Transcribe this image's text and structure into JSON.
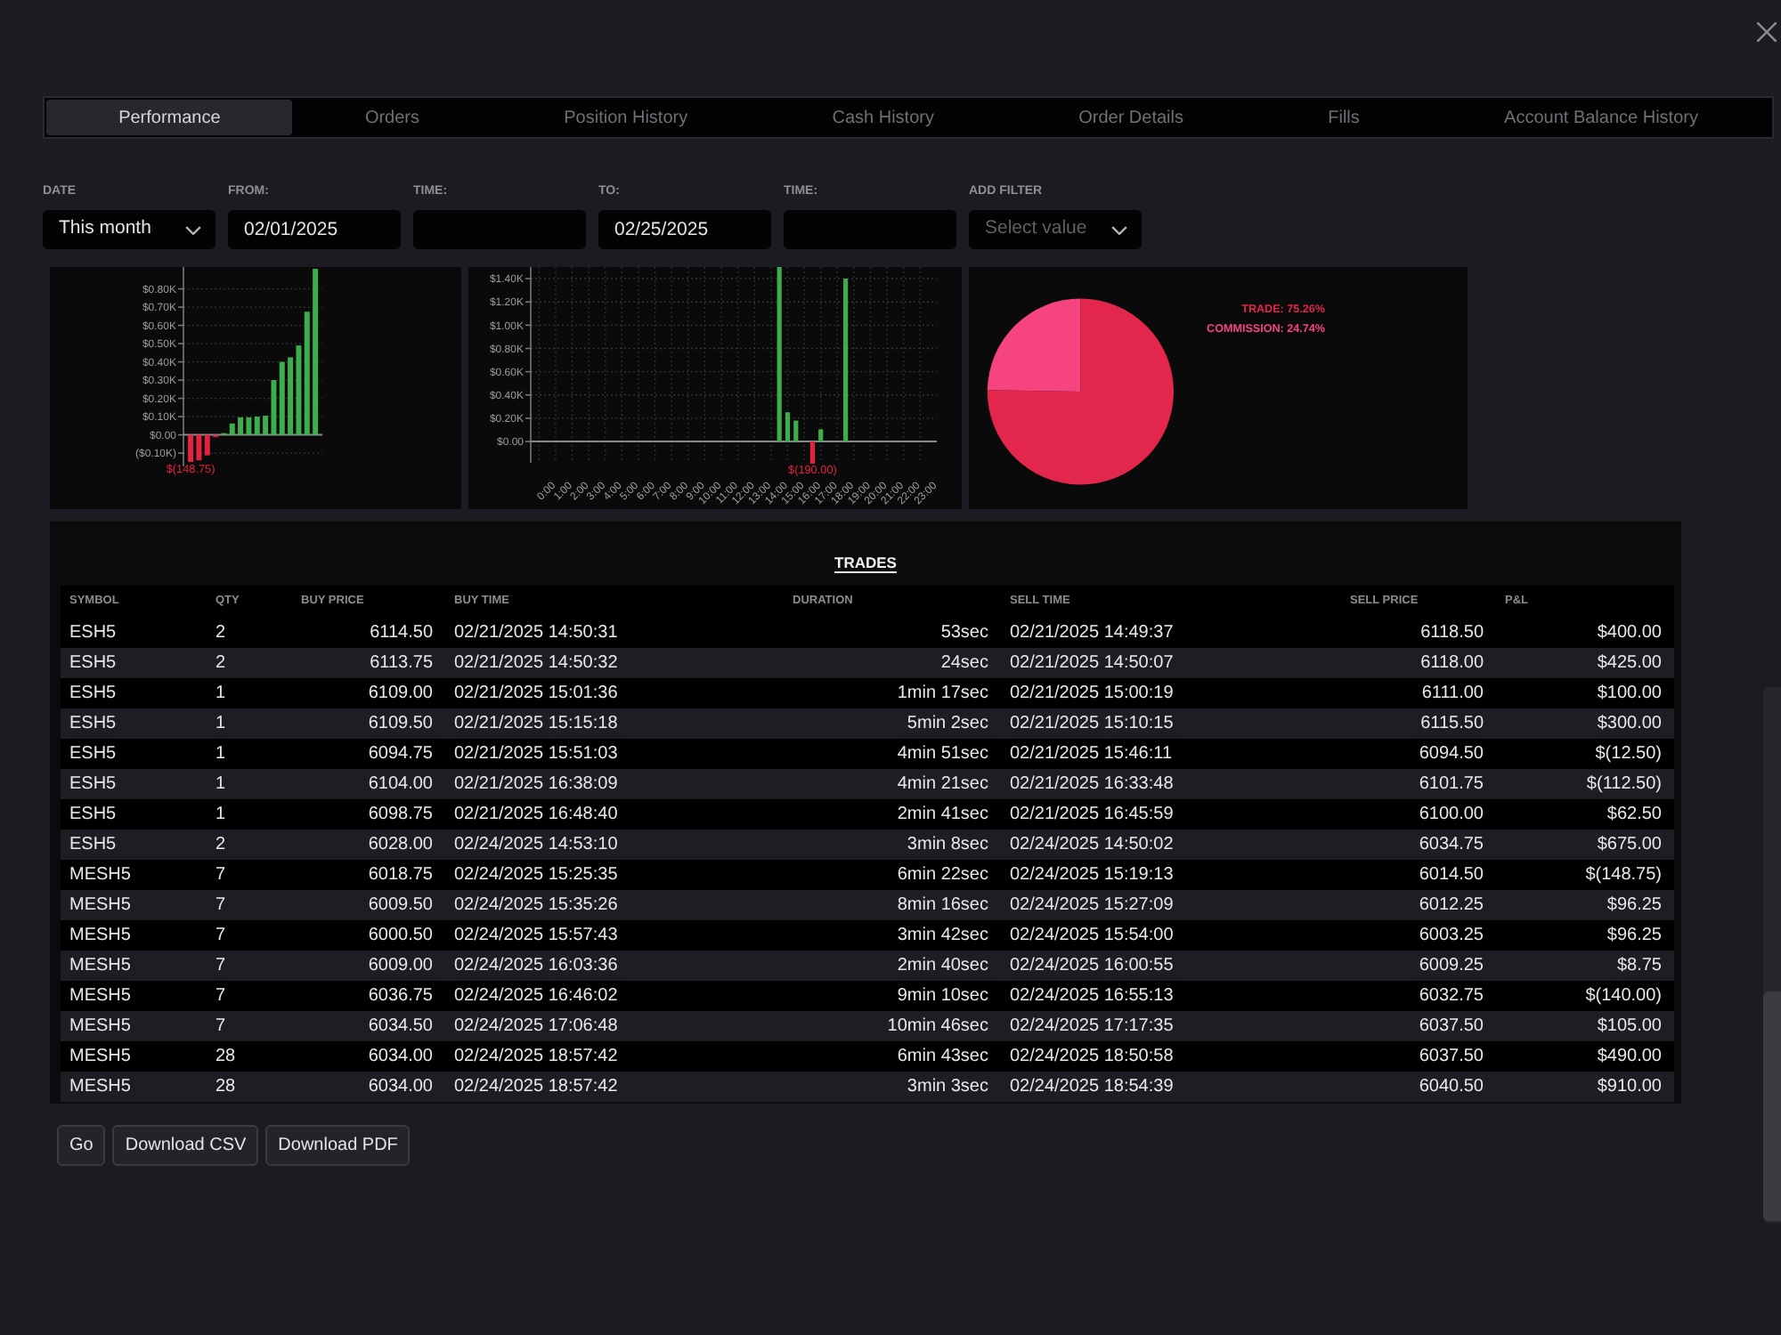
{
  "tabs": [
    {
      "label": "Performance",
      "selected": true
    },
    {
      "label": "Orders",
      "selected": false
    },
    {
      "label": "Position History",
      "selected": false
    },
    {
      "label": "Cash History",
      "selected": false
    },
    {
      "label": "Order Details",
      "selected": false
    },
    {
      "label": "Fills",
      "selected": false
    },
    {
      "label": "Account Balance History",
      "selected": false
    }
  ],
  "filters": [
    {
      "label": "DATE",
      "kind": "select",
      "value": "This month"
    },
    {
      "label": "FROM:",
      "kind": "input",
      "value": "02/01/2025"
    },
    {
      "label": "TIME:",
      "kind": "input"
    },
    {
      "label": "TO:",
      "kind": "input",
      "value": "02/25/2025"
    },
    {
      "label": "TIME:",
      "kind": "input"
    },
    {
      "label": "ADD FILTER",
      "kind": "select",
      "placeholder": "Select value"
    }
  ],
  "charts": [
    {
      "chart_data": {
        "type": "bar",
        "values": [
          -148.75,
          -140,
          -112.5,
          -12.5,
          8.75,
          62.5,
          96.25,
          96.25,
          100,
          105,
          300,
          400,
          425,
          490,
          675,
          910
        ],
        "ylim": [
          -160,
          920
        ],
        "yticks": [
          {
            "value": -100,
            "label": "($0.10K)"
          },
          {
            "value": 0,
            "label": "$0.00"
          },
          {
            "value": 100,
            "label": "$0.10K"
          },
          {
            "value": 200,
            "label": "$0.20K"
          },
          {
            "value": 300,
            "label": "$0.30K"
          },
          {
            "value": 400,
            "label": "$0.40K"
          },
          {
            "value": 500,
            "label": "$0.50K"
          },
          {
            "value": 600,
            "label": "$0.60K"
          },
          {
            "value": 700,
            "label": "$0.70K"
          },
          {
            "value": 800,
            "label": "$0.80K"
          }
        ],
        "grid": true,
        "annotations": [
          "$(148.75)"
        ]
      }
    },
    {
      "chart_data": {
        "type": "bar",
        "x": [
          14.5,
          15,
          15.5,
          16.5,
          17,
          18.5
        ],
        "values": [
          1500,
          251.25,
          180,
          -190,
          105,
          1400
        ],
        "xlim": [
          -0.5,
          24
        ],
        "ylim": [
          -200,
          1500
        ],
        "xticks": [
          {
            "value": 0,
            "label": "0:00"
          },
          {
            "value": 1,
            "label": "1:00"
          },
          {
            "value": 2,
            "label": "2:00"
          },
          {
            "value": 3,
            "label": "3:00"
          },
          {
            "value": 4,
            "label": "4:00"
          },
          {
            "value": 5,
            "label": "5:00"
          },
          {
            "value": 6,
            "label": "6:00"
          },
          {
            "value": 7,
            "label": "7:00"
          },
          {
            "value": 8,
            "label": "8:00"
          },
          {
            "value": 9,
            "label": "9:00"
          },
          {
            "value": 10,
            "label": "10:00"
          },
          {
            "value": 11,
            "label": "11:00"
          },
          {
            "value": 12,
            "label": "12:00"
          },
          {
            "value": 13,
            "label": "13:00"
          },
          {
            "value": 14,
            "label": "14:00"
          },
          {
            "value": 15,
            "label": "15:00"
          },
          {
            "value": 16,
            "label": "16:00"
          },
          {
            "value": 17,
            "label": "17:00"
          },
          {
            "value": 18,
            "label": "18:00"
          },
          {
            "value": 19,
            "label": "19:00"
          },
          {
            "value": 20,
            "label": "20:00"
          },
          {
            "value": 21,
            "label": "21:00"
          },
          {
            "value": 22,
            "label": "22:00"
          },
          {
            "value": 23,
            "label": "23:00"
          }
        ],
        "yticks": [
          {
            "value": 0,
            "label": "$0.00"
          },
          {
            "value": 200,
            "label": "$0.20K"
          },
          {
            "value": 400,
            "label": "$0.40K"
          },
          {
            "value": 600,
            "label": "$0.60K"
          },
          {
            "value": 800,
            "label": "$0.80K"
          },
          {
            "value": 1000,
            "label": "$1.00K"
          },
          {
            "value": 1200,
            "label": "$1.20K"
          },
          {
            "value": 1400,
            "label": "$1.40K"
          }
        ],
        "grid": true,
        "annotations": [
          "$(190.00)"
        ]
      }
    },
    {
      "legend": [
        "TRADE: 75.26%",
        "COMMISSION: 24.74%"
      ],
      "chart_data": {
        "type": "pie",
        "values": [
          75.26,
          24.74
        ]
      }
    }
  ],
  "trades": {
    "title": "TRADES",
    "columns": [
      "SYMBOL",
      "QTY",
      "BUY PRICE",
      "BUY TIME",
      "DURATION",
      "SELL TIME",
      "SELL PRICE",
      "P&L"
    ],
    "rows": [
      [
        "ESH5",
        "2",
        "6114.50",
        "02/21/2025 14:50:31",
        "53sec",
        "02/21/2025 14:49:37",
        "6118.50",
        "$400.00"
      ],
      [
        "ESH5",
        "2",
        "6113.75",
        "02/21/2025 14:50:32",
        "24sec",
        "02/21/2025 14:50:07",
        "6118.00",
        "$425.00"
      ],
      [
        "ESH5",
        "1",
        "6109.00",
        "02/21/2025 15:01:36",
        "1min 17sec",
        "02/21/2025 15:00:19",
        "6111.00",
        "$100.00"
      ],
      [
        "ESH5",
        "1",
        "6109.50",
        "02/21/2025 15:15:18",
        "5min 2sec",
        "02/21/2025 15:10:15",
        "6115.50",
        "$300.00"
      ],
      [
        "ESH5",
        "1",
        "6094.75",
        "02/21/2025 15:51:03",
        "4min 51sec",
        "02/21/2025 15:46:11",
        "6094.50",
        "$(12.50)"
      ],
      [
        "ESH5",
        "1",
        "6104.00",
        "02/21/2025 16:38:09",
        "4min 21sec",
        "02/21/2025 16:33:48",
        "6101.75",
        "$(112.50)"
      ],
      [
        "ESH5",
        "1",
        "6098.75",
        "02/21/2025 16:48:40",
        "2min 41sec",
        "02/21/2025 16:45:59",
        "6100.00",
        "$62.50"
      ],
      [
        "ESH5",
        "2",
        "6028.00",
        "02/24/2025 14:53:10",
        "3min 8sec",
        "02/24/2025 14:50:02",
        "6034.75",
        "$675.00"
      ],
      [
        "MESH5",
        "7",
        "6018.75",
        "02/24/2025 15:25:35",
        "6min 22sec",
        "02/24/2025 15:19:13",
        "6014.50",
        "$(148.75)"
      ],
      [
        "MESH5",
        "7",
        "6009.50",
        "02/24/2025 15:35:26",
        "8min 16sec",
        "02/24/2025 15:27:09",
        "6012.25",
        "$96.25"
      ],
      [
        "MESH5",
        "7",
        "6000.50",
        "02/24/2025 15:57:43",
        "3min 42sec",
        "02/24/2025 15:54:00",
        "6003.25",
        "$96.25"
      ],
      [
        "MESH5",
        "7",
        "6009.00",
        "02/24/2025 16:03:36",
        "2min 40sec",
        "02/24/2025 16:00:55",
        "6009.25",
        "$8.75"
      ],
      [
        "MESH5",
        "7",
        "6036.75",
        "02/24/2025 16:46:02",
        "9min 10sec",
        "02/24/2025 16:55:13",
        "6032.75",
        "$(140.00)"
      ],
      [
        "MESH5",
        "7",
        "6034.50",
        "02/24/2025 17:06:48",
        "10min 46sec",
        "02/24/2025 17:17:35",
        "6037.50",
        "$105.00"
      ],
      [
        "MESH5",
        "28",
        "6034.00",
        "02/24/2025 18:57:42",
        "6min 43sec",
        "02/24/2025 18:50:58",
        "6037.50",
        "$490.00"
      ],
      [
        "MESH5",
        "28",
        "6034.00",
        "02/24/2025 18:57:42",
        "3min 3sec",
        "02/24/2025 18:54:39",
        "6040.50",
        "$910.00"
      ]
    ]
  },
  "buttons": [
    "Go",
    "Download CSV",
    "Download PDF"
  ]
}
